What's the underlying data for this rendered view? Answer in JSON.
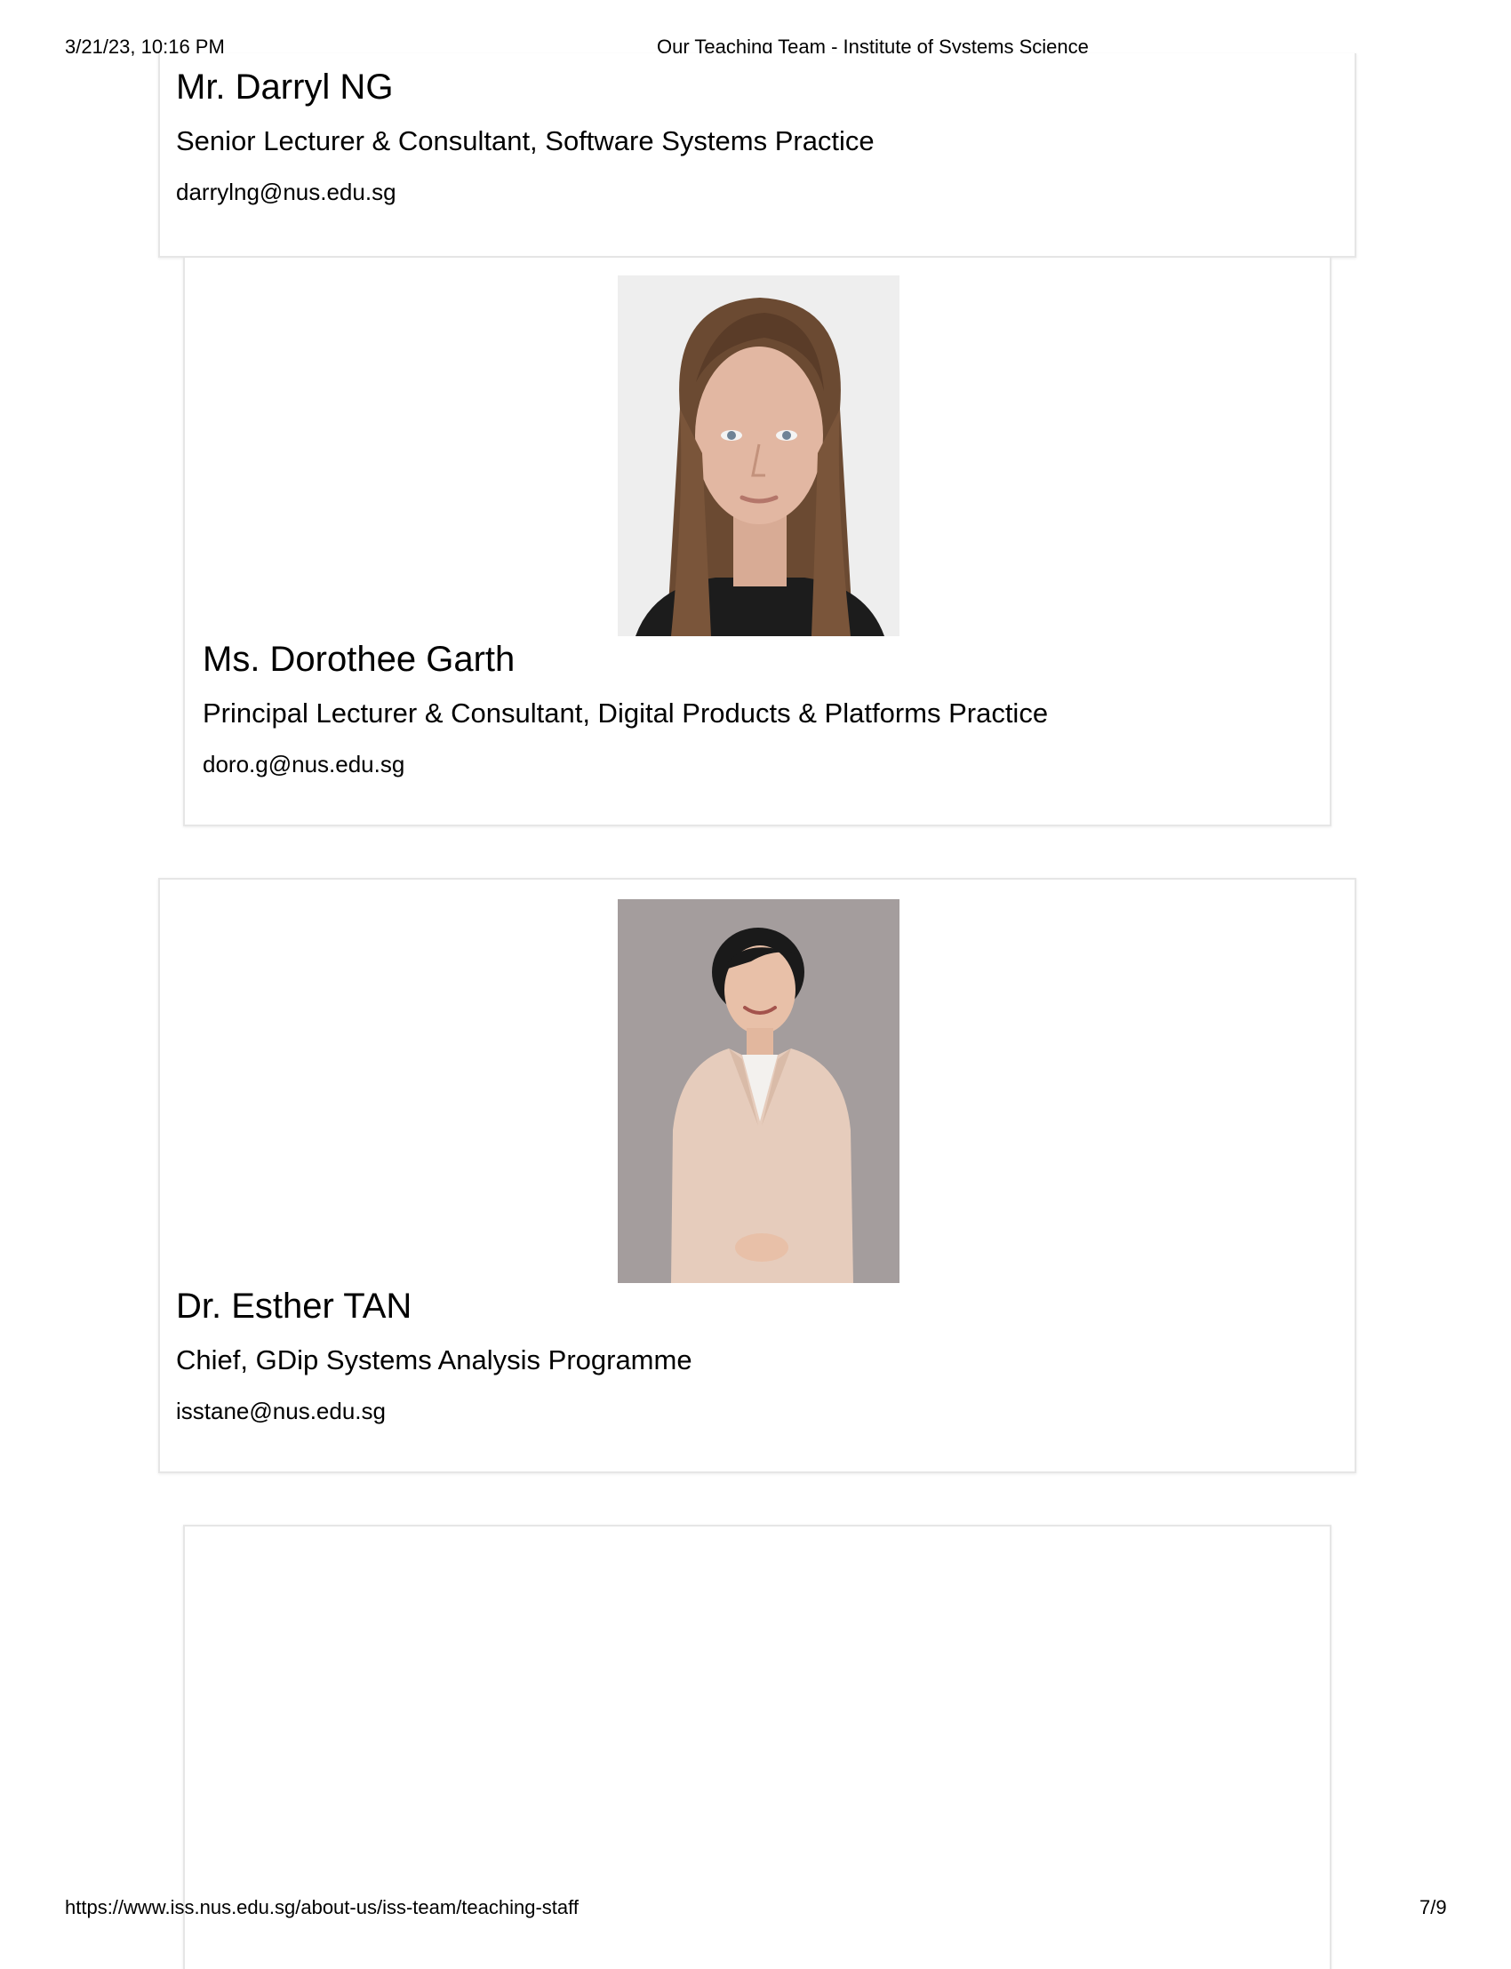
{
  "header": {
    "datetime": "3/21/23, 10:16 PM",
    "title": "Our Teaching Team - Institute of Systems Science"
  },
  "staff": [
    {
      "name": "Mr. Darryl NG",
      "role": "Senior Lecturer & Consultant, Software Systems Practice",
      "email": "darrylng@nus.edu.sg"
    },
    {
      "name": "Ms. Dorothee Garth",
      "role": "Principal Lecturer & Consultant, Digital Products & Platforms Practice",
      "email": "doro.g@nus.edu.sg"
    },
    {
      "name": "Dr. Esther TAN",
      "role": "Chief, GDip Systems Analysis Programme",
      "email": "isstane@nus.edu.sg"
    }
  ],
  "footer": {
    "url": "https://www.iss.nus.edu.sg/about-us/iss-team/teaching-staff",
    "page": "7/9"
  },
  "colors": {
    "card_border": "#e6e6e6",
    "text": "#000000"
  }
}
